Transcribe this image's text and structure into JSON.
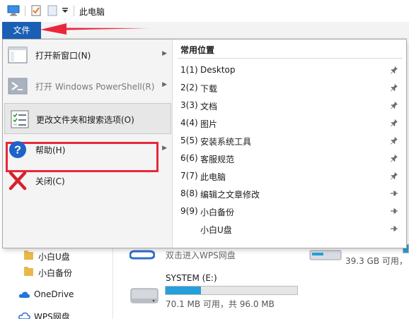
{
  "titlebar": {
    "title": "此电脑",
    "icons": [
      "computer-icon",
      "properties-checkbox-icon",
      "new-folder-icon",
      "customize-quick-access-icon"
    ]
  },
  "file_tab": {
    "label": "文件"
  },
  "menu": {
    "items": [
      {
        "label": "打开新窗口(N)",
        "icon": "new-window-icon",
        "has_submenu": true,
        "enabled": true
      },
      {
        "label": "打开 Windows PowerShell(R)",
        "icon": "powershell-icon",
        "has_submenu": true,
        "enabled": false
      },
      {
        "label": "更改文件夹和搜索选项(O)",
        "icon": "folder-options-icon",
        "has_submenu": false,
        "enabled": true,
        "highlighted": true
      },
      {
        "label": "帮助(H)",
        "icon": "help-icon",
        "has_submenu": true,
        "enabled": true
      },
      {
        "label": "关闭(C)",
        "icon": "close-icon",
        "has_submenu": false,
        "enabled": true
      }
    ],
    "recent_title": "常用位置",
    "recent": [
      {
        "key": "1(1)",
        "name": "Desktop",
        "pin": "pinned"
      },
      {
        "key": "2(2)",
        "name": "下载",
        "pin": "pinned"
      },
      {
        "key": "3(3)",
        "name": "文档",
        "pin": "pinned"
      },
      {
        "key": "4(4)",
        "name": "图片",
        "pin": "pinned"
      },
      {
        "key": "5(5)",
        "name": "安装系统工具",
        "pin": "pinned"
      },
      {
        "key": "6(6)",
        "name": "客服规范",
        "pin": "pinned"
      },
      {
        "key": "7(7)",
        "name": "此电脑",
        "pin": "pinned"
      },
      {
        "key": "8(8)",
        "name": "编辑之文章修改",
        "pin": "unpinned"
      },
      {
        "key": "9(9)",
        "name": "小白备份",
        "pin": "unpinned"
      },
      {
        "key": "",
        "name": "小白U盘",
        "pin": "unpinned"
      }
    ]
  },
  "nav": {
    "items": [
      {
        "label": "小白U盘",
        "icon": "folder-icon"
      },
      {
        "label": "小白备份",
        "icon": "folder-icon"
      },
      {
        "label": "OneDrive",
        "icon": "onedrive-icon"
      },
      {
        "label": "WPS网盘",
        "icon": "wps-cloud-icon"
      }
    ]
  },
  "content": {
    "wps_label": "双击进入WPS网盘",
    "drive_c_free_text": "39.3 GB 可用，",
    "drive_e": {
      "name": "SYSTEM (E:)",
      "usage_text": "70.1 MB 可用，共 96.0 MB",
      "used_fraction": 0.27
    }
  },
  "colors": {
    "accent": "#1a5fb4",
    "highlight_border": "#e8283a",
    "arrow": "#e8283a",
    "drive_fill": "#26a0da"
  }
}
